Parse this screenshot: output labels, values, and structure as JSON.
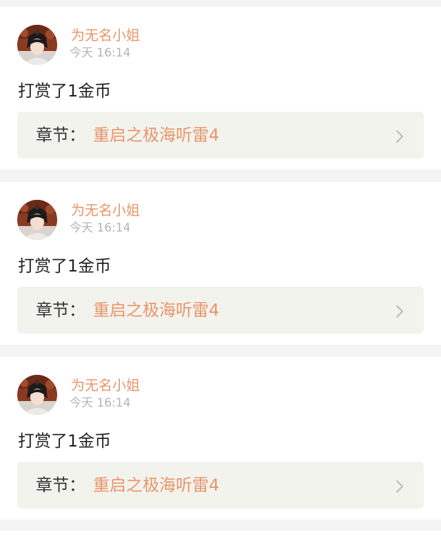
{
  "feed": {
    "items": [
      {
        "username": "为无名小姐",
        "timestamp": "今天 16:14",
        "message": "打赏了1金币",
        "chapter_prefix": "章节：",
        "chapter_title": "重启之极海听雷4"
      },
      {
        "username": "为无名小姐",
        "timestamp": "今天 16:14",
        "message": "打赏了1金币",
        "chapter_prefix": "章节：",
        "chapter_title": "重启之极海听雷4"
      },
      {
        "username": "为无名小姐",
        "timestamp": "今天 16:14",
        "message": "打赏了1金币",
        "chapter_prefix": "章节：",
        "chapter_title": "重启之极海听雷4"
      }
    ]
  },
  "icons": {
    "avatar": "user-avatar-photo",
    "chevron": "chevron-right-icon"
  },
  "colors": {
    "page_background": "#f5f4f2",
    "card_background": "#ffffff",
    "accent": "#e8956a",
    "muted_text": "#b3b3b3",
    "body_text": "#222222",
    "chapter_background": "#f3f3ee"
  }
}
